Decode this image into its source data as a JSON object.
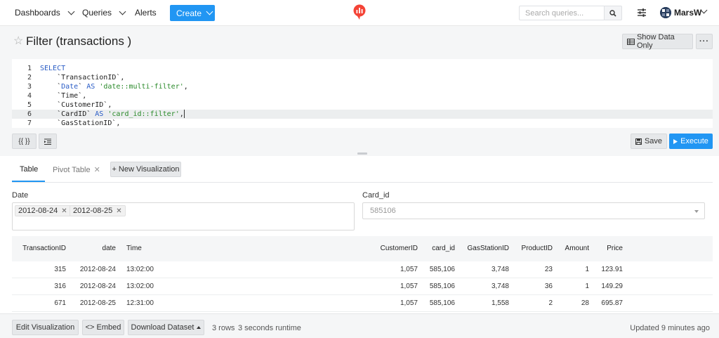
{
  "nav": {
    "dashboards": "Dashboards",
    "queries": "Queries",
    "alerts": "Alerts",
    "create": "Create",
    "search_placeholder": "Search queries...",
    "user_name": "MarsW",
    "brand_color": "#f44336",
    "accent_color": "#2196f3"
  },
  "title": {
    "text": "Filter (transactions )",
    "show_data_only": "Show Data Only",
    "more": "···"
  },
  "editor": {
    "lines": [
      {
        "n": "1",
        "code": [
          {
            "t": "SELECT",
            "c": "kw"
          }
        ]
      },
      {
        "n": "2",
        "code": [
          {
            "t": "    `TransactionID`,",
            "c": ""
          }
        ]
      },
      {
        "n": "3",
        "code": [
          {
            "t": "    `",
            "c": ""
          },
          {
            "t": "Date",
            "c": "kw"
          },
          {
            "t": "` ",
            "c": ""
          },
          {
            "t": "AS",
            "c": "kw"
          },
          {
            "t": " ",
            "c": ""
          },
          {
            "t": "'date::multi-filter'",
            "c": "str"
          },
          {
            "t": ",",
            "c": ""
          }
        ]
      },
      {
        "n": "4",
        "code": [
          {
            "t": "    `Time`,",
            "c": ""
          }
        ]
      },
      {
        "n": "5",
        "code": [
          {
            "t": "    `CustomerID`,",
            "c": ""
          }
        ]
      },
      {
        "n": "6",
        "code": [
          {
            "t": "    `CardID` ",
            "c": ""
          },
          {
            "t": "AS",
            "c": "kw"
          },
          {
            "t": " ",
            "c": ""
          },
          {
            "t": "'card_id::filter'",
            "c": "str"
          },
          {
            "t": ",",
            "c": ""
          }
        ],
        "active": true
      },
      {
        "n": "7",
        "code": [
          {
            "t": "    `GasStationID`,",
            "c": ""
          }
        ]
      }
    ],
    "format_btn": "{{ }}",
    "save": "Save",
    "execute": "Execute"
  },
  "results": {
    "tabs": {
      "table": "Table",
      "pivot": "Pivot Table",
      "new_viz": "+ New Visualization"
    },
    "filters": {
      "date_label": "Date",
      "date_tags": [
        "2012-08-24",
        "2012-08-25"
      ],
      "card_label": "Card_id",
      "card_value": "585106"
    },
    "columns": [
      "TransactionID",
      "date",
      "Time",
      "CustomerID",
      "card_id",
      "GasStationID",
      "ProductID",
      "Amount",
      "Price"
    ],
    "rows": [
      [
        "315",
        "2012-08-24",
        "13:02:00",
        "1,057",
        "585,106",
        "3,748",
        "23",
        "1",
        "123.91"
      ],
      [
        "316",
        "2012-08-24",
        "13:02:00",
        "1,057",
        "585,106",
        "3,748",
        "36",
        "1",
        "149.29"
      ],
      [
        "671",
        "2012-08-25",
        "12:31:00",
        "1,057",
        "585,106",
        "1,558",
        "2",
        "28",
        "695.87"
      ]
    ]
  },
  "footer": {
    "edit_viz": "Edit Visualization",
    "embed": "<> Embed",
    "download": "Download Dataset",
    "rows": "3 rows",
    "runtime": "3 seconds runtime",
    "updated": "Updated 9 minutes ago"
  }
}
